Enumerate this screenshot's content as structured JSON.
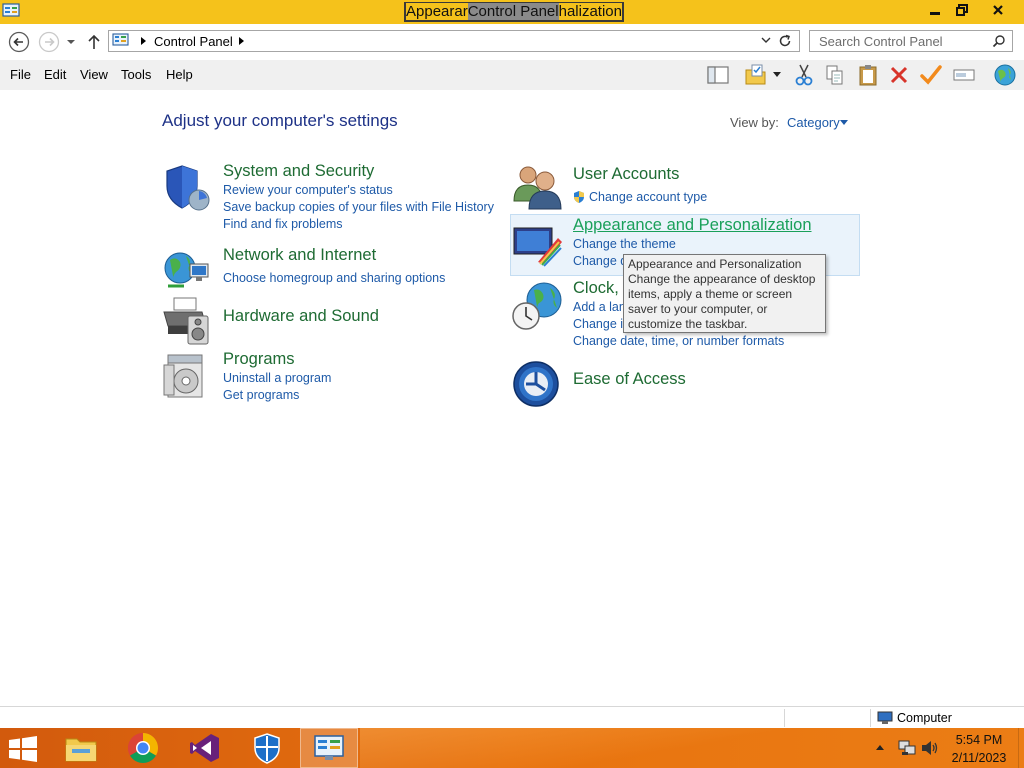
{
  "window": {
    "title_parts": [
      "Appearar",
      "Control Panel",
      "halization"
    ],
    "accent_color": "#f5c21b"
  },
  "address": {
    "crumb": "Control Panel"
  },
  "search": {
    "placeholder": "Search Control Panel"
  },
  "menu": [
    "File",
    "Edit",
    "View",
    "Tools",
    "Help"
  ],
  "content": {
    "heading": "Adjust your computer's settings",
    "view_by_label": "View by:",
    "view_by_value": "Category",
    "categories": [
      {
        "title": "System and Security",
        "icon": "shield-icon",
        "links": [
          "Review your computer's status",
          "Save backup copies of your files with File History",
          "Find and fix problems"
        ]
      },
      {
        "title": "Network and Internet",
        "icon": "globe-network-icon",
        "links": [
          "Choose homegroup and sharing options"
        ]
      },
      {
        "title": "Hardware and Sound",
        "icon": "printer-speaker-icon",
        "links": []
      },
      {
        "title": "Programs",
        "icon": "programs-icon",
        "links": [
          "Uninstall a program",
          "Get programs"
        ]
      },
      {
        "title": "User Accounts",
        "icon": "users-icon",
        "links": [
          "Change account type"
        ]
      },
      {
        "title": "Appearance and Personalization",
        "icon": "appearance-icon",
        "links": [
          "Change the theme",
          "Change d"
        ]
      },
      {
        "title": "Clock, L",
        "icon": "clock-globe-icon",
        "links": [
          "Add a lan",
          "Change in",
          "Change date, time, or number formats"
        ]
      },
      {
        "title": "Ease of Access",
        "icon": "ease-of-access-icon",
        "links": []
      }
    ]
  },
  "tooltip": {
    "title": "Appearance and Personalization",
    "body": "Change the appearance of desktop items, apply a theme or screen saver to your computer, or customize the taskbar."
  },
  "status": {
    "location": "Computer"
  },
  "taskbar": {
    "apps": [
      "file-explorer-icon",
      "chrome-icon",
      "visual-studio-icon",
      "defender-icon",
      "control-panel-icon"
    ],
    "time": "5:54 PM",
    "date": "2/11/2023"
  }
}
